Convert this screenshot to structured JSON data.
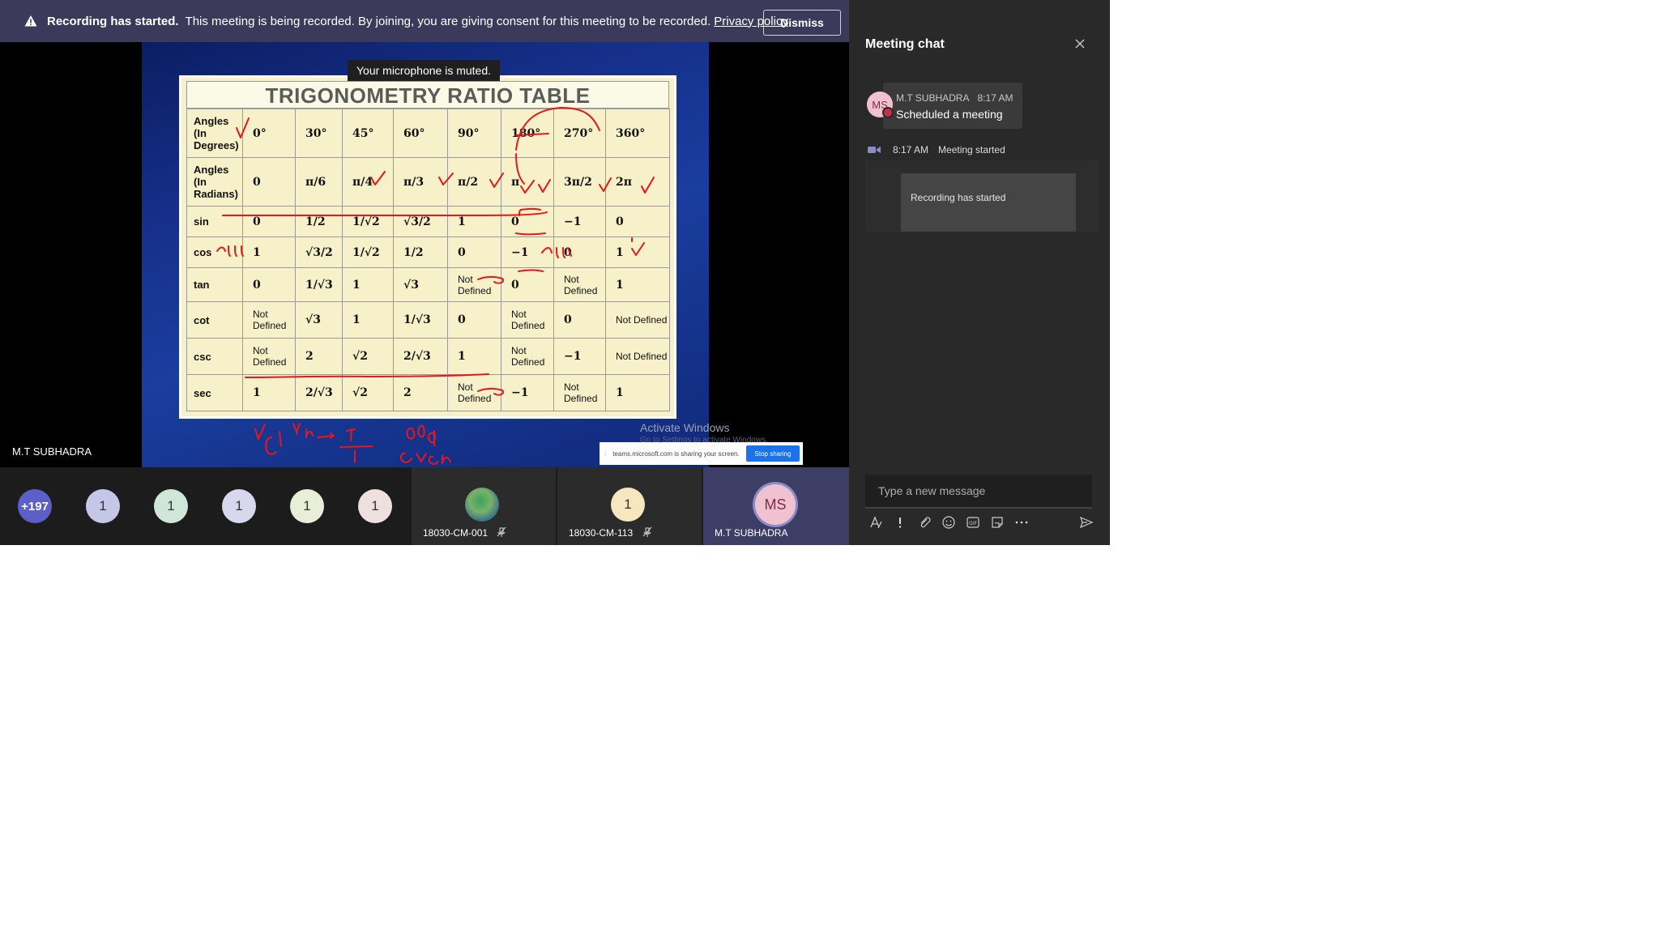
{
  "banner": {
    "title": "Recording has started.",
    "message": "This meeting is being recorded. By joining, you are giving consent for this meeting to be recorded.",
    "link": "Privacy policy",
    "dismiss_label": "Dismiss"
  },
  "toast": {
    "mic_muted": "Your microphone is muted."
  },
  "slide": {
    "title": "TRIGONOMETRY RATIO TABLE",
    "rows": [
      {
        "head": "Angles (In Degrees)",
        "cells": [
          "0°",
          "30°",
          "45°",
          "60°",
          "90°",
          "180°",
          "270°",
          "360°"
        ]
      },
      {
        "head": "Angles (In Radians)",
        "cells": [
          "0",
          "π/6",
          "π/4",
          "π/3",
          "π/2",
          "π",
          "3π/2",
          "2π"
        ]
      },
      {
        "head": "sin",
        "cells": [
          "0",
          "1/2",
          "1/√2",
          "√3/2",
          "1",
          "0",
          "−1",
          "0"
        ]
      },
      {
        "head": "cos",
        "cells": [
          "1",
          "√3/2",
          "1/√2",
          "1/2",
          "0",
          "−1",
          "0",
          "1"
        ]
      },
      {
        "head": "tan",
        "cells": [
          "0",
          "1/√3",
          "1",
          "√3",
          "Not Defined",
          "0",
          "Not Defined",
          "1"
        ]
      },
      {
        "head": "cot",
        "cells": [
          "Not Defined",
          "√3",
          "1",
          "1/√3",
          "0",
          "Not Defined",
          "0",
          "Not Defined"
        ]
      },
      {
        "head": "csc",
        "cells": [
          "Not Defined",
          "2",
          "√2",
          "2/√3",
          "1",
          "Not Defined",
          "−1",
          "Not Defined"
        ]
      },
      {
        "head": "sec",
        "cells": [
          "1",
          "2/√3",
          "√2",
          "2",
          "Not Defined",
          "−1",
          "Not Defined",
          "1"
        ]
      }
    ]
  },
  "screen_share": {
    "activate_title": "Activate Windows",
    "activate_sub": "Go to Settings to activate Windows.",
    "sharing_text": "teams.microsoft.com is sharing your screen.",
    "stop_label": "Stop sharing"
  },
  "presenter": {
    "name": "M.T SUBHADRA"
  },
  "participants": {
    "overflow": "+197",
    "bubbles": [
      "1",
      "1",
      "1",
      "1",
      "1"
    ],
    "tiles": [
      {
        "name": "18030-CM-001"
      },
      {
        "name": "18030-CM-113",
        "initial": "1"
      },
      {
        "name": "M.T SUBHADRA",
        "initials": "MS"
      }
    ]
  },
  "chat": {
    "title": "Meeting chat",
    "message": {
      "avatar": "MS",
      "sender": "M.T SUBHADRA",
      "time": "8:17 AM",
      "text": "Scheduled a meeting"
    },
    "system": {
      "time": "8:17 AM",
      "text": "Meeting started"
    },
    "recording_card": "Recording has started",
    "compose_placeholder": "Type a new message"
  },
  "colors": {
    "accent": "#6264a7",
    "banner_bg": "#3b3a5a",
    "ink_red": "#e8161b"
  }
}
